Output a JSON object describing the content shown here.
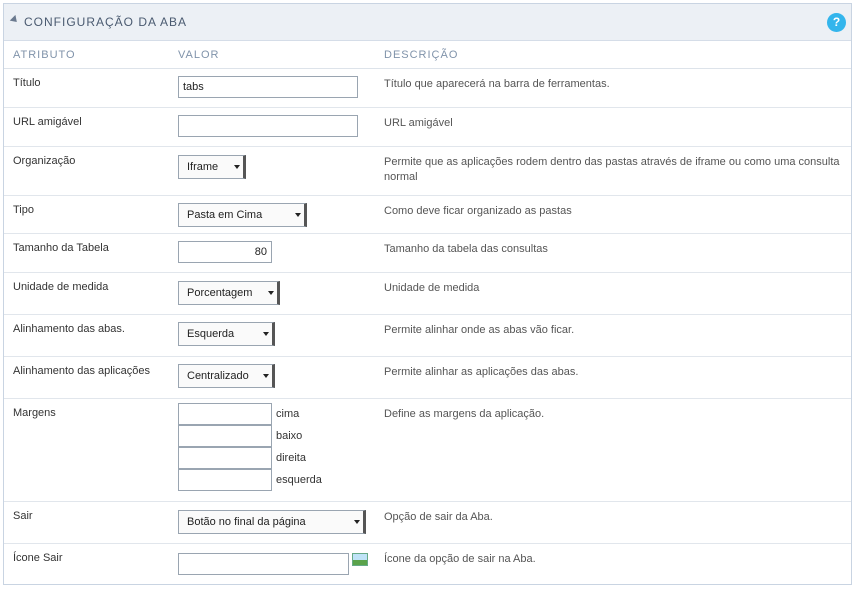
{
  "header": {
    "title": "CONFIGURAÇÃO DA ABA",
    "help": "?"
  },
  "columns": {
    "attr": "ATRIBUTO",
    "value": "VALOR",
    "desc": "DESCRIÇÃO"
  },
  "rows": {
    "titulo": {
      "label": "Título",
      "value": "tabs",
      "desc": "Título que aparecerá na barra de ferramentas."
    },
    "url": {
      "label": "URL amigável",
      "value": "",
      "desc": "URL amigável"
    },
    "organizacao": {
      "label": "Organização",
      "value": "Iframe",
      "desc": "Permite que as aplicações rodem dentro das pastas através de iframe ou como uma consulta normal"
    },
    "tipo": {
      "label": "Tipo",
      "value": "Pasta em Cima",
      "desc": "Como deve ficar organizado as pastas"
    },
    "tamanho": {
      "label": "Tamanho da Tabela",
      "value": "80",
      "desc": "Tamanho da tabela das consultas"
    },
    "unidade": {
      "label": "Unidade de medida",
      "value": "Porcentagem",
      "desc": "Unidade de medida"
    },
    "alinhamento_abas": {
      "label": "Alinhamento das abas.",
      "value": "Esquerda",
      "desc": "Permite alinhar onde as abas vão ficar."
    },
    "alinhamento_apps": {
      "label": "Alinhamento das aplicações",
      "value": "Centralizado",
      "desc": "Permite alinhar as aplicações das abas."
    },
    "margens": {
      "label": "Margens",
      "cima": "cima",
      "baixo": "baixo",
      "direita": "direita",
      "esquerda": "esquerda",
      "desc": "Define as margens da aplicação."
    },
    "sair": {
      "label": "Sair",
      "value": "Botão no final da página",
      "desc": "Opção de sair da Aba."
    },
    "icone_sair": {
      "label": "Ícone Sair",
      "value": "",
      "icon": "image-picker-icon",
      "desc": "Ícone da opção de sair na Aba."
    }
  }
}
